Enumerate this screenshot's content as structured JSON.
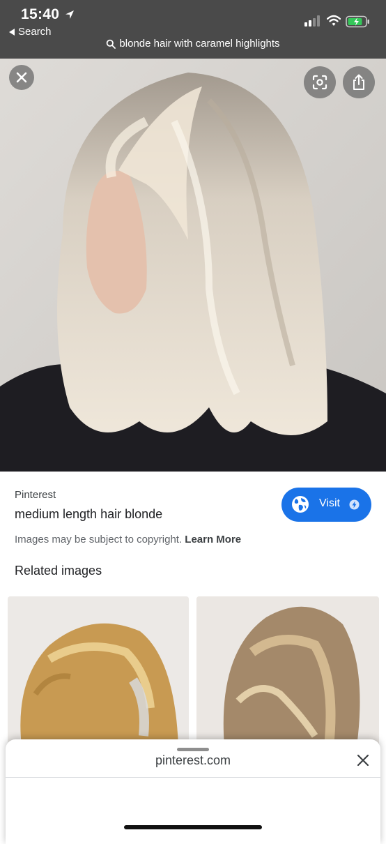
{
  "status_bar": {
    "time": "15:40",
    "back_label": "Search"
  },
  "search": {
    "query": "blonde hair with caramel highlights"
  },
  "result": {
    "source": "Pinterest",
    "title": "medium length hair blonde",
    "visit_label": "Visit",
    "copyright_text": "Images may be subject to copyright.",
    "learn_more": "Learn More"
  },
  "related": {
    "heading": "Related images"
  },
  "sheet": {
    "url": "pinterest.com"
  },
  "colors": {
    "accent": "#1a73e8",
    "status_bg": "#4a4a4a",
    "battery_green": "#34c759"
  },
  "icons": [
    "location-arrow-icon",
    "back-arrow-icon",
    "signal-icon",
    "wifi-icon",
    "battery-icon",
    "search-icon",
    "close-icon",
    "lens-icon",
    "share-icon",
    "globe-icon",
    "amp-bolt-icon"
  ]
}
